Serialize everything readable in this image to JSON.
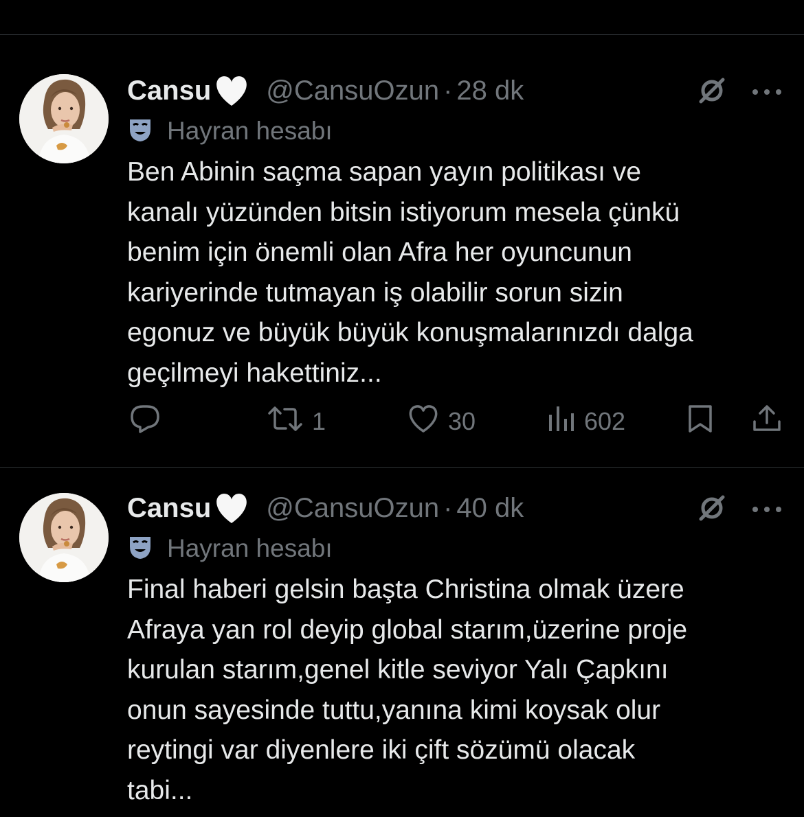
{
  "tweets": [
    {
      "display_name": "Cansu",
      "handle": "@CansuOzun",
      "separator": "·",
      "time": "28 dk",
      "label": "Hayran hesabı",
      "lines": [
        "Ben Abinin saçma sapan yayın politikası ve",
        "kanalı yüzünden bitsin istiyorum mesela çünkü",
        "benim için önemli olan Afra her oyuncunun",
        "kariyerinde tutmayan iş olabilir sorun sizin",
        "egonuz ve büyük büyük konuşmalarınızdı dalga",
        "geçilmeyi hakettiniz..."
      ],
      "retweets": "1",
      "likes": "30",
      "views": "602"
    },
    {
      "display_name": "Cansu",
      "handle": "@CansuOzun",
      "separator": "·",
      "time": "40 dk",
      "label": "Hayran hesabı",
      "lines": [
        "Final haberi gelsin başta Christina olmak üzere",
        "Afraya yan rol deyip global starım,üzerine proje",
        "kurulan starım,genel kitle seviyor Yalı Çapkını",
        "onun sayesinde tuttu,yanına kimi koysak olur",
        "reytingi var diyenlere iki çift sözümü olacak",
        "tabi..."
      ]
    }
  ],
  "icons": {
    "heart_emoji": "white-heart-icon",
    "label_icon": "theater-mask-icon",
    "grok": "grok-icon",
    "more": "more-icon",
    "reply": "reply-icon",
    "retweet": "retweet-icon",
    "like": "like-icon",
    "views": "views-icon",
    "bookmark": "bookmark-icon",
    "share": "share-icon"
  },
  "colors": {
    "background": "#000000",
    "text": "#e7e9ea",
    "secondary": "#71767b",
    "divider": "#2f3336"
  }
}
